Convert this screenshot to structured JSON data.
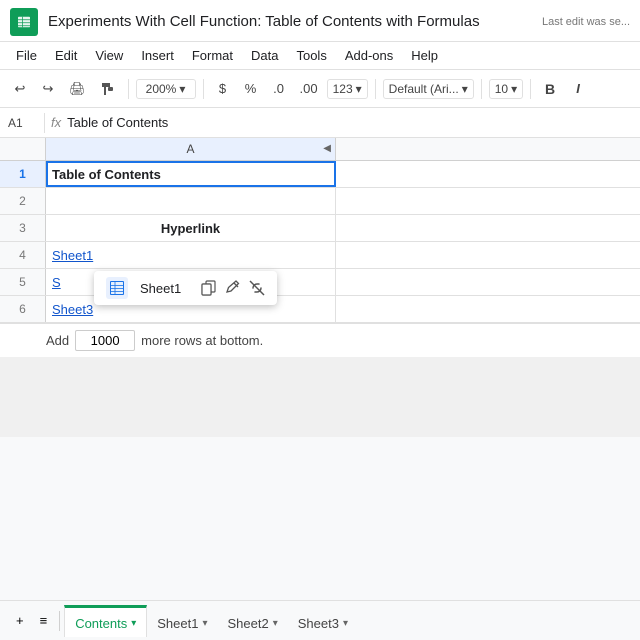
{
  "titleBar": {
    "docTitle": "Experiments With Cell Function: Table of Contents with Formulas",
    "lastEdit": "Last edit was se..."
  },
  "menuBar": {
    "items": [
      "File",
      "Edit",
      "View",
      "Insert",
      "Format",
      "Data",
      "Tools",
      "Add-ons",
      "Help"
    ]
  },
  "toolbar": {
    "undo": "↩",
    "redo": "↪",
    "print": "🖨",
    "paintFormat": "🪣",
    "zoom": "200%",
    "dollarSign": "$",
    "percent": "%",
    "decDecimals": ".0",
    "incDecimals": ".00",
    "format123": "123",
    "fontFamily": "Default (Ari...",
    "fontSize": "10",
    "bold": "B",
    "italic": "I"
  },
  "formulaBar": {
    "cellRef": "A1",
    "fx": "fx",
    "content": "Table of Contents"
  },
  "colHeader": "A",
  "rows": [
    {
      "num": "1",
      "content": "Table of Contents",
      "style": "bold selected"
    },
    {
      "num": "2",
      "content": "",
      "style": ""
    },
    {
      "num": "3",
      "content": "Hyperlink",
      "style": "bold center"
    },
    {
      "num": "4",
      "content": "Sheet1",
      "style": "link"
    },
    {
      "num": "5",
      "content": "S",
      "style": "link-partial"
    },
    {
      "num": "6",
      "content": "Sheet3",
      "style": "link"
    }
  ],
  "hyperlinkPopup": {
    "sheetName": "Sheet1",
    "copyIcon": "⧉",
    "editIcon": "✎",
    "unlinkIcon": "⛓"
  },
  "addRows": {
    "addLabel": "Add",
    "count": "1000",
    "suffix": "more rows at bottom."
  },
  "tabs": [
    {
      "label": "Contents",
      "active": true
    },
    {
      "label": "Sheet1",
      "active": false
    },
    {
      "label": "Sheet2",
      "active": false
    },
    {
      "label": "Sheet3",
      "active": false
    }
  ],
  "tabBarIcons": {
    "addSheet": "+",
    "allSheets": "≡"
  }
}
